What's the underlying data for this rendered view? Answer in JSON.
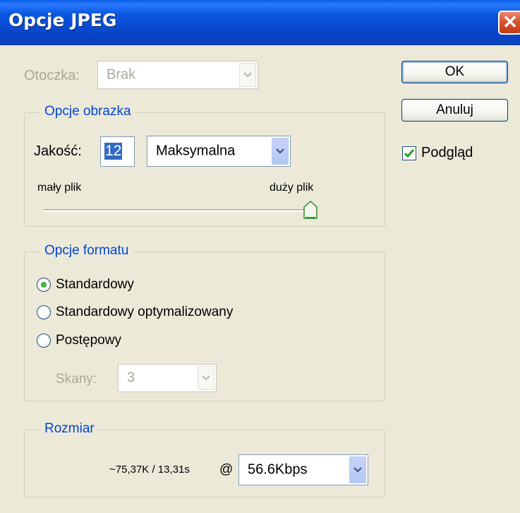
{
  "window": {
    "title": "Opcje JPEG",
    "close_glyph": "✕"
  },
  "matte": {
    "label": "Otoczka:",
    "value": "Brak",
    "enabled": false
  },
  "buttons": {
    "ok": "OK",
    "cancel": "Anuluj"
  },
  "preview": {
    "label": "Podgląd",
    "checked": true
  },
  "image_options": {
    "title": "Opcje obrazka",
    "quality_label": "Jakość:",
    "quality_value": "12",
    "quality_preset": "Maksymalna",
    "small_file_label": "mały plik",
    "large_file_label": "duży plik",
    "quality_level_fraction": 1.0
  },
  "format_options": {
    "title": "Opcje formatu",
    "options": [
      {
        "label": "Standardowy",
        "selected": true
      },
      {
        "label": "Standardowy optymalizowany",
        "selected": false
      },
      {
        "label": "Postępowy",
        "selected": false
      }
    ],
    "scans_label": "Skany:",
    "scans_value": "3",
    "scans_enabled": false
  },
  "size": {
    "title": "Rozmiar",
    "estimate": "~75,37K / 13,31s",
    "at": "@",
    "speed": "56.6Kbps"
  },
  "colors": {
    "title_bar": "#0846CC",
    "group_title": "#0046D5",
    "dialog_bg": "#ECE9D8"
  }
}
